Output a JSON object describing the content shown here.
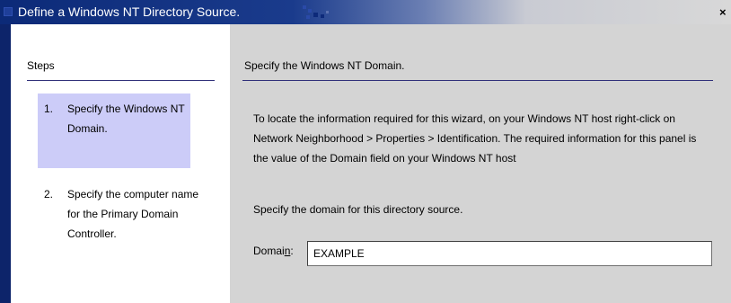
{
  "window": {
    "title": "Define a Windows NT Directory Source.",
    "close_label": "×"
  },
  "steps": {
    "heading": "Steps",
    "items": [
      {
        "number": "1.",
        "label": "Specify the Windows NT Domain.",
        "active": true
      },
      {
        "number": "2.",
        "label": "Specify the computer name for the Primary Domain Controller.",
        "active": false
      }
    ]
  },
  "panel": {
    "heading": "Specify the Windows NT Domain.",
    "info": "To locate the information required for this wizard, on your Windows NT host right-click on Network Neighborhood > Properties > Identification. The required information for this panel is the value of the Domain field on your Windows NT host",
    "prompt": "Specify the domain for this directory source.",
    "domain_label_prefix": "Domai",
    "domain_label_mnemonic": "n",
    "domain_label_suffix": ":",
    "domain_value": "EXAMPLE"
  },
  "colors": {
    "titlebar": "#0c2a78",
    "active_step": "#ccccf8",
    "rule": "#30307a"
  }
}
